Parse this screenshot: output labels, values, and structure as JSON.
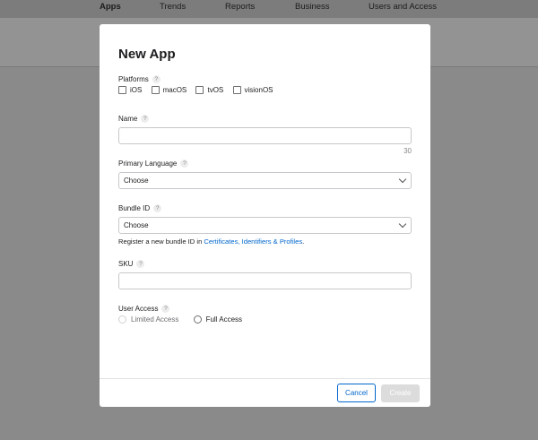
{
  "topnav": {
    "items": [
      {
        "label": "Apps",
        "active": true
      },
      {
        "label": "Trends",
        "active": false
      },
      {
        "label": "Reports",
        "active": false
      },
      {
        "label": "Business",
        "active": false
      },
      {
        "label": "Users and Access",
        "active": false
      }
    ]
  },
  "modal": {
    "title": "New App",
    "help_glyph": "?",
    "platforms": {
      "label": "Platforms",
      "options": [
        {
          "label": "iOS",
          "checked": false
        },
        {
          "label": "macOS",
          "checked": false
        },
        {
          "label": "tvOS",
          "checked": false
        },
        {
          "label": "visionOS",
          "checked": false
        }
      ]
    },
    "name": {
      "label": "Name",
      "value": "",
      "char_limit": "30"
    },
    "primary_language": {
      "label": "Primary Language",
      "selected": "Choose"
    },
    "bundle_id": {
      "label": "Bundle ID",
      "selected": "Choose",
      "note_prefix": "Register a new bundle ID in ",
      "note_link": "Certificates, Identifiers & Profiles",
      "note_suffix": "."
    },
    "sku": {
      "label": "SKU",
      "value": ""
    },
    "user_access": {
      "label": "User Access",
      "options": [
        {
          "label": "Limited Access",
          "selected": false
        },
        {
          "label": "Full Access",
          "selected": false
        }
      ]
    },
    "buttons": {
      "cancel": "Cancel",
      "create": "Create",
      "create_enabled": false
    }
  },
  "colors": {
    "accent": "#0066cc",
    "overlay": "#8a8a8a",
    "disabled_button": "#dcdcdc"
  }
}
